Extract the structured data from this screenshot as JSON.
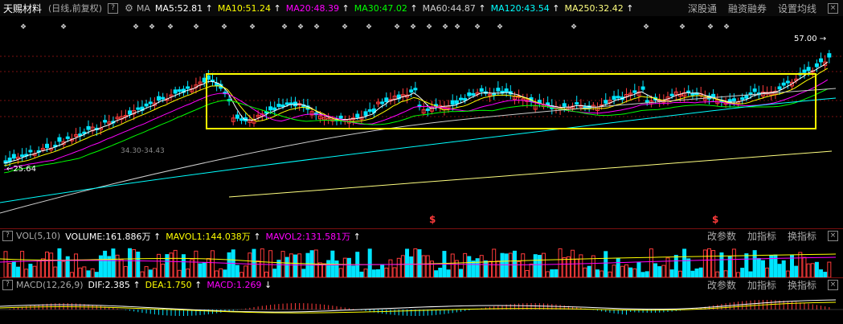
{
  "header": {
    "stock_name": "天赐材料",
    "period": "(日线,前复权)",
    "indicator": "MA",
    "ma": [
      {
        "label": "MA5:52.81",
        "arrow": "↑",
        "color": "#ffffff"
      },
      {
        "label": "MA10:51.24",
        "arrow": "↑",
        "color": "#ffff00"
      },
      {
        "label": "MA20:48.39",
        "arrow": "↑",
        "color": "#ff00ff"
      },
      {
        "label": "MA30:47.02",
        "arrow": "↑",
        "color": "#00ff00"
      },
      {
        "label": "MA60:44.87",
        "arrow": "↑",
        "color": "#cccccc"
      },
      {
        "label": "MA120:43.54",
        "arrow": "↑",
        "color": "#00ffff"
      },
      {
        "label": "MA250:32.42",
        "arrow": "↑",
        "color": "#ffff80"
      }
    ],
    "buttons": [
      "深股通",
      "融资融券",
      "设置均线"
    ],
    "close": "×"
  },
  "price_labels": {
    "high": "57.00",
    "low": "25.64",
    "range": "34.30-34.43",
    "marker": "$"
  },
  "vol": {
    "indicator": "VOL(5,10)",
    "items": [
      {
        "label": "VOLUME:161.886万",
        "arrow": "↑",
        "color": "#ffffff"
      },
      {
        "label": "MAVOL1:144.038万",
        "arrow": "↑",
        "color": "#ffff00"
      },
      {
        "label": "MAVOL2:131.581万",
        "arrow": "↑",
        "color": "#ff00ff"
      }
    ],
    "buttons": [
      "改参数",
      "加指标",
      "换指标"
    ]
  },
  "macd": {
    "indicator": "MACD(12,26,9)",
    "items": [
      {
        "label": "DIF:2.385",
        "arrow": "↑",
        "color": "#ffffff"
      },
      {
        "label": "DEA:1.750",
        "arrow": "↑",
        "color": "#ffff00"
      },
      {
        "label": "MACD:1.269",
        "arrow": "↓",
        "color": "#ff00ff"
      }
    ],
    "buttons": [
      "改参数",
      "加指标",
      "换指标"
    ]
  },
  "colors": {
    "up": "#ff3b3b",
    "down": "#00e5ff",
    "highlight": "#ffff00",
    "grid": "#7a1010"
  }
}
